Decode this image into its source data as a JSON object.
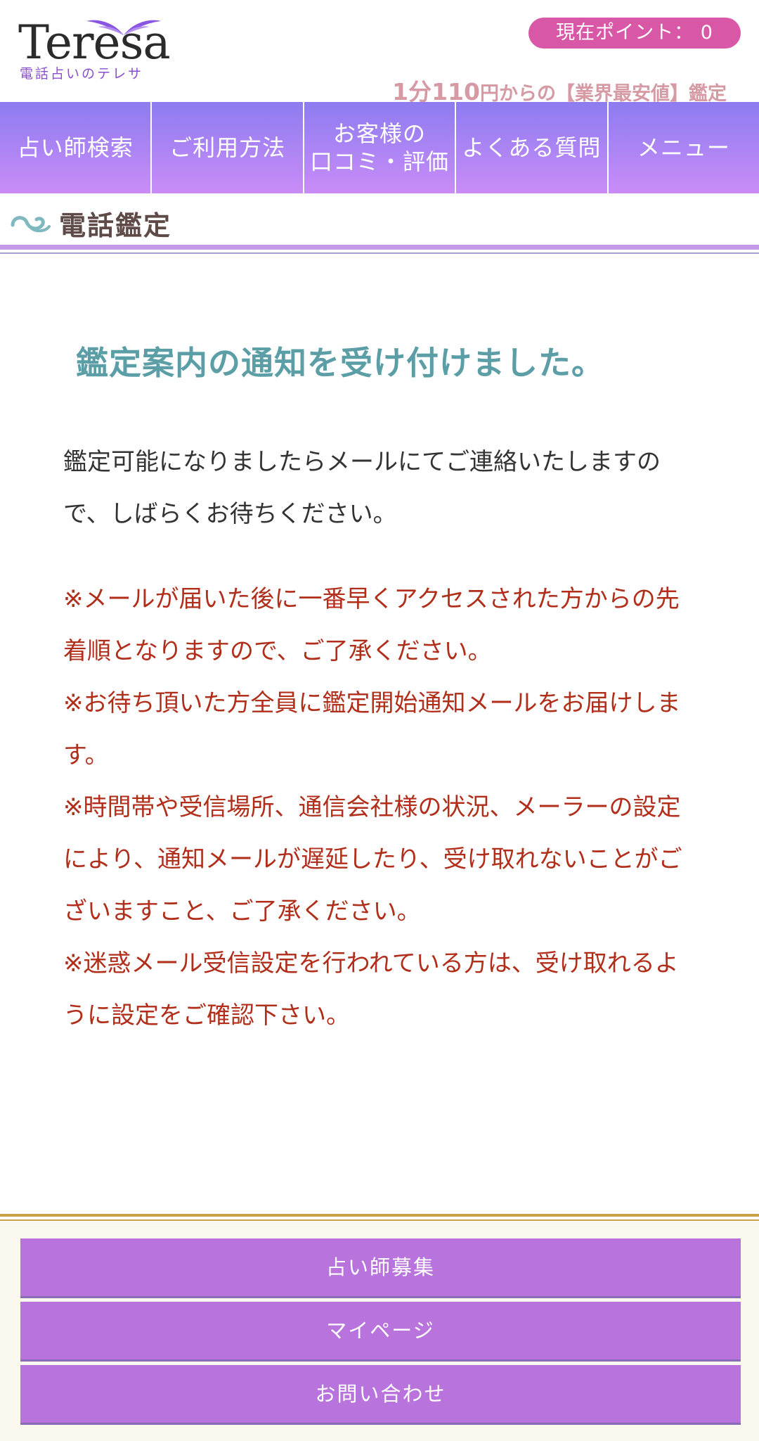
{
  "header": {
    "logo_text": "Teresa",
    "logo_sub": "電話占いのテレサ",
    "points_label": "現在ポイント：",
    "points_value": "0",
    "tagline_num": "1分110",
    "tagline_rest": "円からの【業界最安値】鑑定"
  },
  "nav": {
    "items": [
      {
        "label": "占い師検索"
      },
      {
        "label": "ご利用方法"
      },
      {
        "label": "お客様の\n口コミ・評価"
      },
      {
        "label": "よくある質問"
      },
      {
        "label": "メニュー"
      }
    ]
  },
  "section": {
    "title": "電話鑑定"
  },
  "content": {
    "notice_title": "鑑定案内の通知を受け付けました。",
    "body": "鑑定可能になりましたらメールにてご連絡いたしますので、しばらくお待ちください。",
    "notes": [
      "※メールが届いた後に一番早くアクセスされた方からの先着順となりますので、ご了承ください。",
      "※お待ち頂いた方全員に鑑定開始通知メールをお届けします。",
      "※時間帯や受信場所、通信会社様の状況、メーラーの設定により、通知メールが遅延したり、受け取れないことがございますこと、ご了承ください。",
      "※迷惑メール受信設定を行われている方は、受け取れるように設定をご確認下さい。"
    ]
  },
  "footer": {
    "items": [
      {
        "label": "占い師募集"
      },
      {
        "label": "マイページ"
      },
      {
        "label": "お問い合わせ"
      }
    ]
  },
  "colors": {
    "accent_pink": "#d857a6",
    "nav_gradient_top": "#8d7cf0",
    "nav_gradient_bottom": "#c98cf7",
    "notice_teal": "#5b9ea6",
    "note_red": "#b02e1a",
    "footer_purple": "#b874dc"
  }
}
